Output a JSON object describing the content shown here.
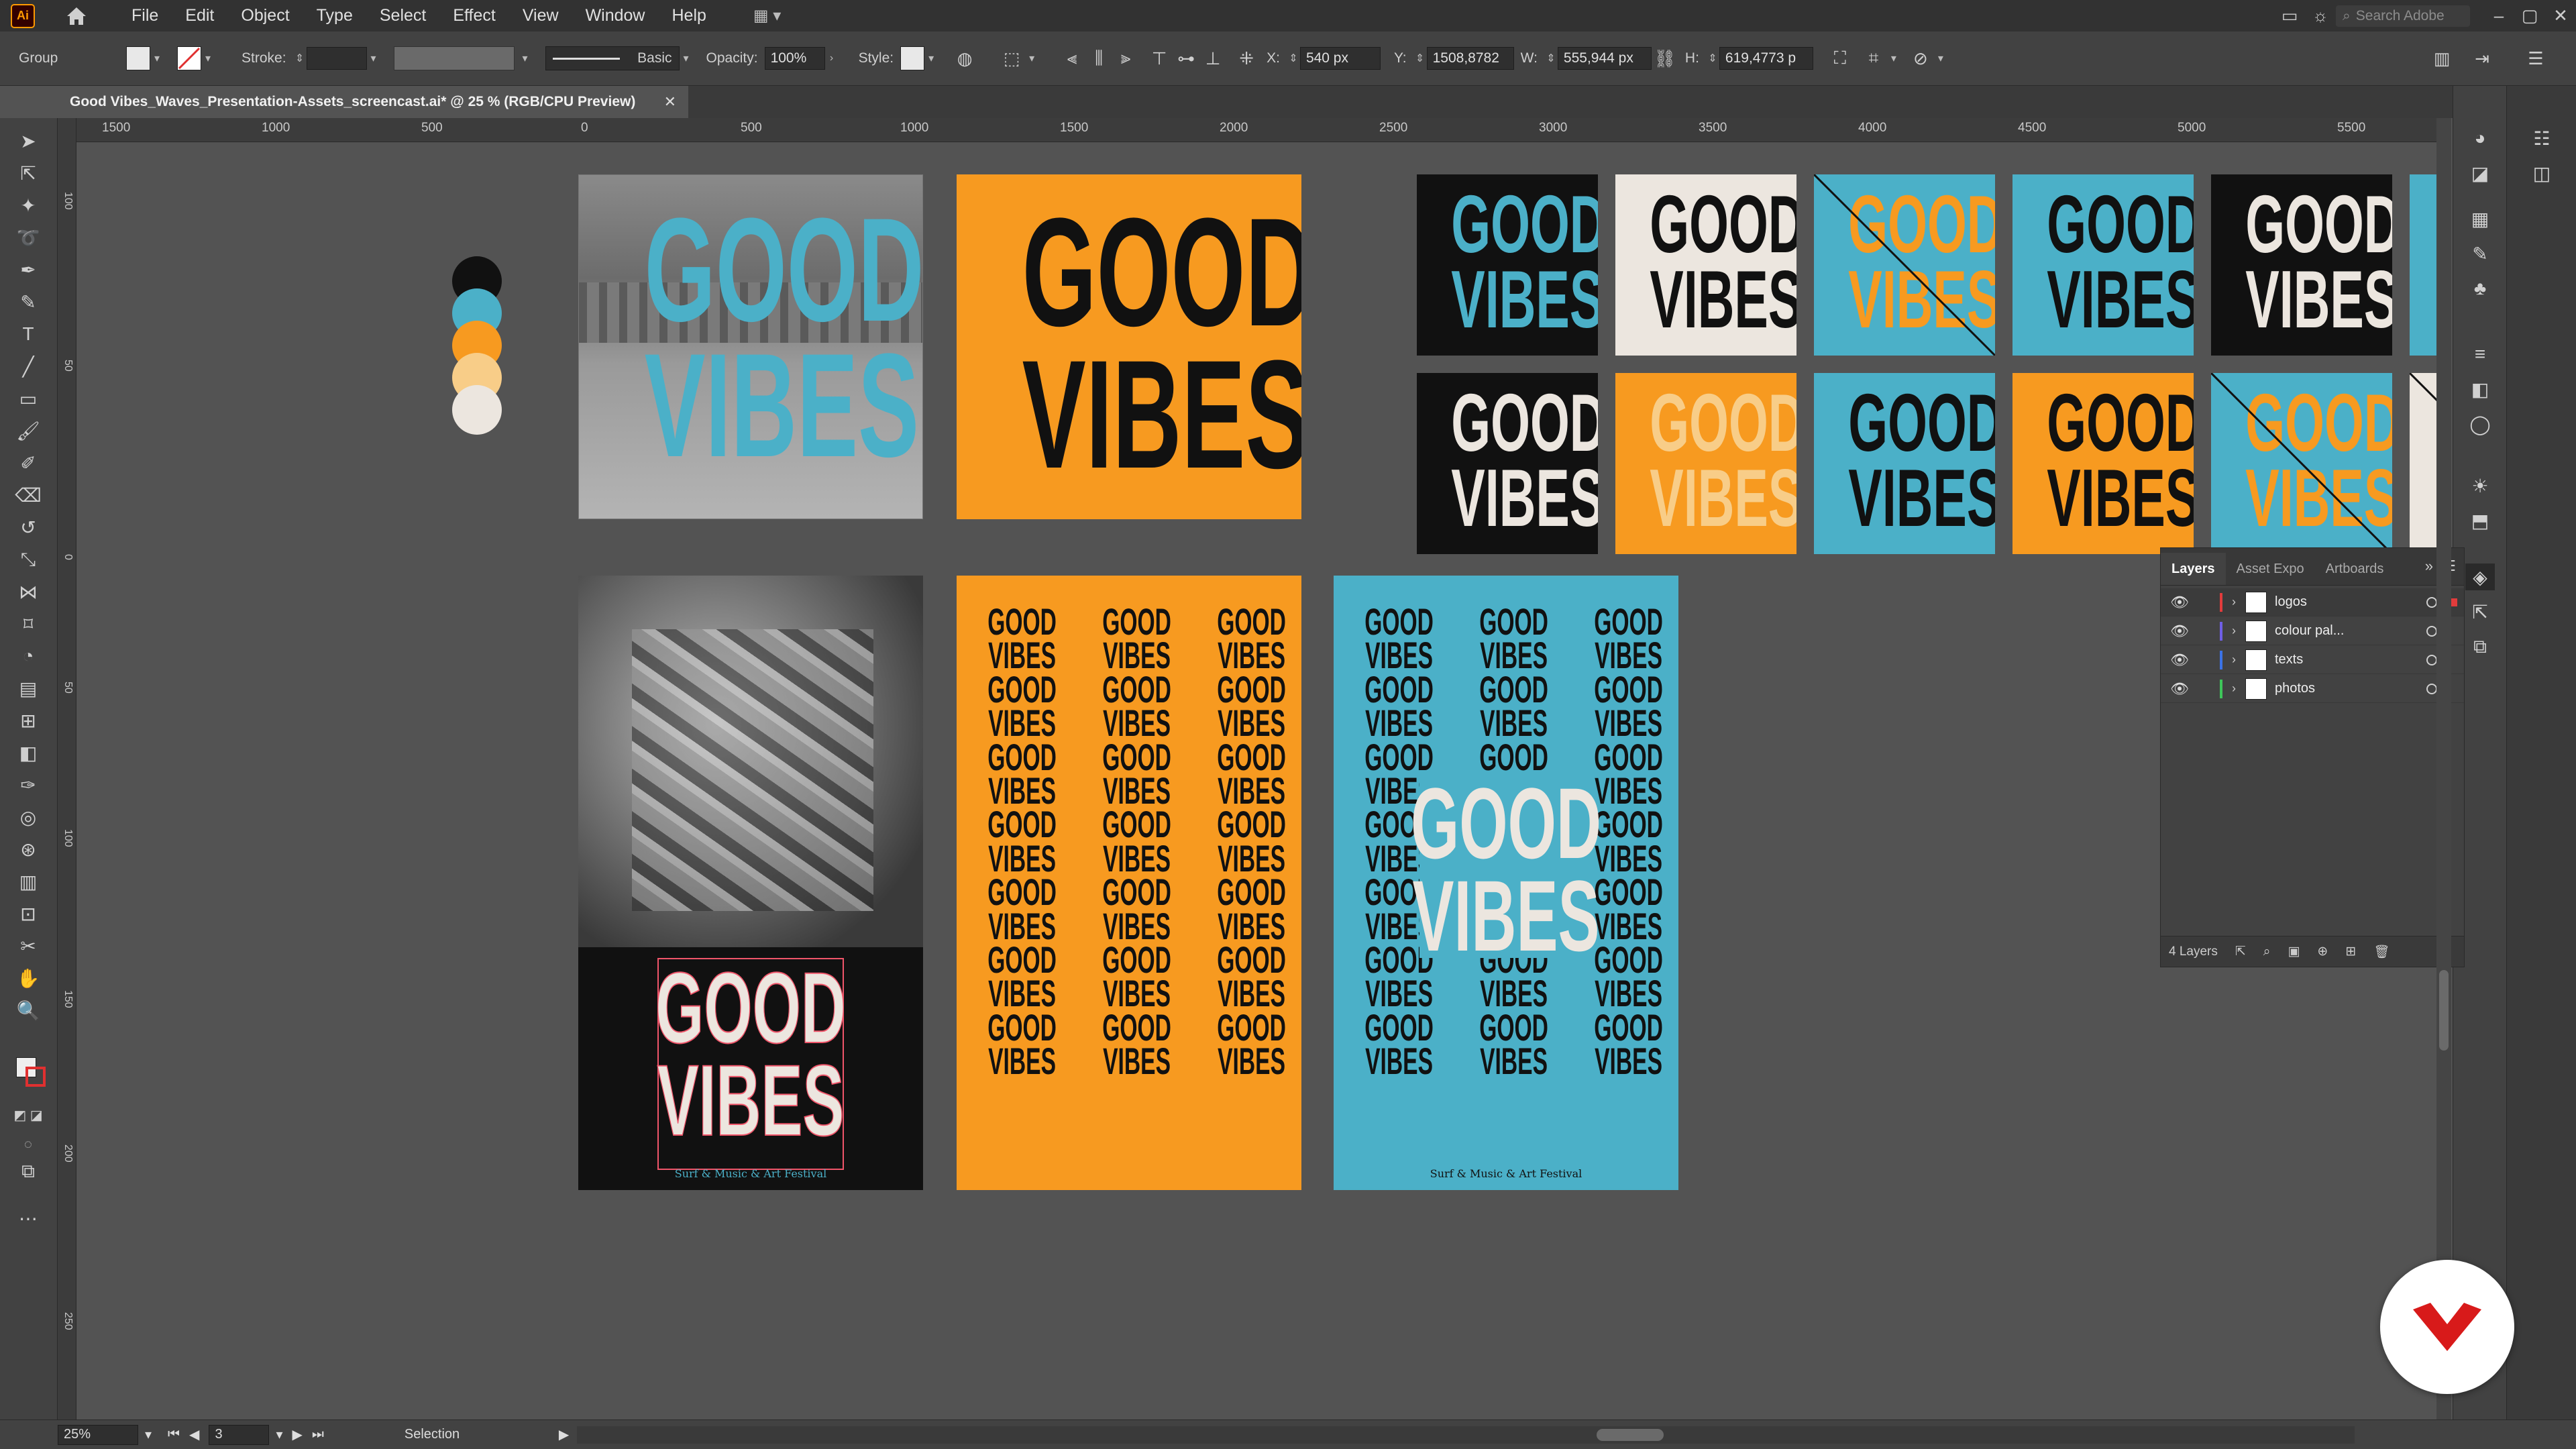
{
  "app": {
    "logo": "Ai",
    "menu": [
      "File",
      "Edit",
      "Object",
      "Type",
      "Select",
      "Effect",
      "View",
      "Window",
      "Help"
    ],
    "search_placeholder": "Search Adobe"
  },
  "controlbar": {
    "selection_type": "Group",
    "stroke_label": "Stroke:",
    "brush": "Basic",
    "opacity_label": "Opacity:",
    "opacity": "100%",
    "style_label": "Style:",
    "x_label": "X:",
    "x_value": "540 px",
    "y_label": "Y:",
    "y_value": "1508,8782",
    "w_label": "W:",
    "w_value": "555,944 px",
    "h_label": "H:",
    "h_value": "619,4773 p"
  },
  "document": {
    "tab_title": "Good Vibes_Waves_Presentation-Assets_screencast.ai* @ 25 % (RGB/CPU Preview)"
  },
  "ruler": {
    "labels": [
      "1500",
      "1000",
      "500",
      "0",
      "500",
      "1000",
      "1500",
      "2000",
      "2500",
      "3000",
      "3500",
      "4000",
      "4500",
      "5000",
      "5500"
    ],
    "vertical_labels": [
      "100",
      "50",
      "0",
      "50",
      "100",
      "150",
      "200",
      "250"
    ]
  },
  "artwork": {
    "logo_line1": "GOOD",
    "logo_line2": "VIBES",
    "pattern_line1": "GOOD",
    "pattern_line2": "VIBES",
    "festival_caption": "Surf & Music & Art Festival"
  },
  "colors": {
    "black": "#111111",
    "blue": "#4bb0c8",
    "orange": "#f79a20",
    "peach": "#f8cd88",
    "cream": "#ece6df"
  },
  "layers_panel": {
    "tabs": [
      "Layers",
      "Asset Expo",
      "Artboards"
    ],
    "layers": [
      {
        "name": "logos",
        "color": "#e23c3c"
      },
      {
        "name": "colour pal...",
        "color": "#6f5fe6"
      },
      {
        "name": "texts",
        "color": "#3b73e6"
      },
      {
        "name": "photos",
        "color": "#3ec65a"
      }
    ],
    "count": "4 Layers"
  },
  "statusbar": {
    "zoom": "25%",
    "artboard_num": "3",
    "tool": "Selection"
  }
}
